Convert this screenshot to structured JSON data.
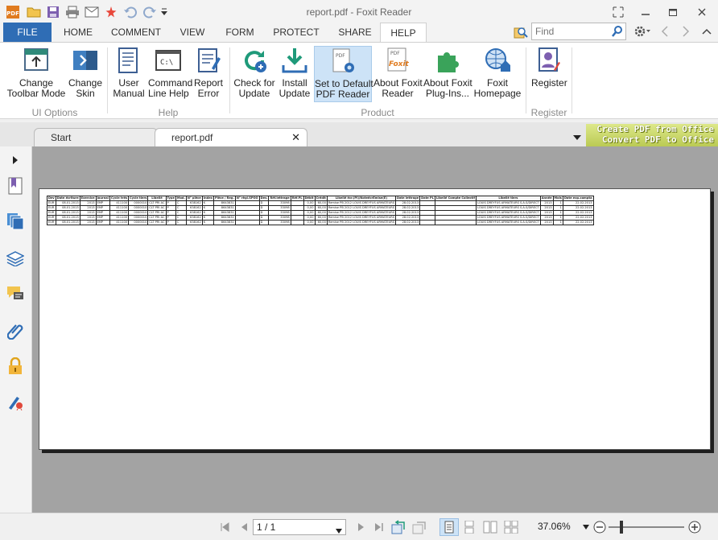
{
  "window": {
    "title": "report.pdf - Foxit Reader"
  },
  "ribbon_tabs": [
    {
      "label": "FILE"
    },
    {
      "label": "HOME"
    },
    {
      "label": "COMMENT"
    },
    {
      "label": "VIEW"
    },
    {
      "label": "FORM"
    },
    {
      "label": "PROTECT"
    },
    {
      "label": "SHARE"
    },
    {
      "label": "HELP"
    }
  ],
  "search": {
    "placeholder": "Find"
  },
  "ribbon": {
    "buttons": [
      {
        "l1": "Change",
        "l2": "Toolbar Mode"
      },
      {
        "l1": "Change",
        "l2": "Skin"
      },
      {
        "l1": "User",
        "l2": "Manual"
      },
      {
        "l1": "Command",
        "l2": "Line Help"
      },
      {
        "l1": "Report",
        "l2": "Error"
      },
      {
        "l1": "Check for",
        "l2": "Update"
      },
      {
        "l1": "Install",
        "l2": "Update"
      },
      {
        "l1": "Set to Default",
        "l2": "PDF Reader"
      },
      {
        "l1": "About Foxit",
        "l2": "Reader"
      },
      {
        "l1": "About Foxit",
        "l2": "Plug-Ins..."
      },
      {
        "l1": "Foxit",
        "l2": "Homepage"
      },
      {
        "l1": "Register",
        "l2": ""
      }
    ],
    "groups": [
      "UI Options",
      "Help",
      "Product",
      "Register"
    ]
  },
  "doc_tabs": [
    {
      "label": "Start"
    },
    {
      "label": "report.pdf"
    }
  ],
  "promo": {
    "line1": "Create PDF from Office",
    "line2": "Convert PDF to Office"
  },
  "pdf_table": {
    "headers": [
      "Dev",
      "Date écriture",
      "Exercice",
      "Journal",
      "Cycle trés",
      "Cycle tiers",
      "Libellé",
      "Type",
      "Mod.",
      "N° pièce",
      "Index",
      "Pièce / Reg.",
      "N° règl.SPOO",
      "Dev.",
      "Réf.lettrage",
      "Réf.PL",
      "Débit",
      "Crédit",
      "Libellé écr.(PI)/NoteécrEmise(E)",
      "Date lettrage",
      "Date PL",
      "Libellé Compte Collectif",
      "Libellé tiers",
      "Année",
      "Mois",
      "Date exp.compta"
    ],
    "rows": [
      [
        "EUR",
        "08.01.2013",
        "2013",
        "EMP",
        "411100",
        "0000010",
        "CLT PRI AC",
        "P",
        "C",
        "638162",
        "K",
        "8643831",
        "",
        "D",
        "33098",
        "",
        "0,00",
        "60,00",
        "Remise PB 2012 LOUIS DREYFUS ARMATEURS",
        "28.02.2013",
        "",
        "",
        "LOUIS DREYFUS ARMATEURS S.A.S/DIRECT",
        "2013",
        "1",
        "22.02.2013"
      ],
      [
        "EUR",
        "08.01.2013",
        "2013",
        "EMP",
        "411100",
        "0000010",
        "CLT PRI AC",
        "P",
        "C",
        "638162",
        "K",
        "8643831",
        "",
        "D",
        "33098",
        "",
        "0,00",
        "60,00",
        "Remise PB 2012 LOUIS DREYFUS ARMATEURS",
        "28.02.2013",
        "",
        "",
        "LOUIS DREYFUS ARMATEURS S.A.S/DIRECT",
        "2013",
        "1",
        "22.02.2013"
      ],
      [
        "EUR",
        "08.01.2013",
        "2013",
        "EMP",
        "411100",
        "0000010",
        "CLT PRI AC",
        "P",
        "C",
        "638162",
        "K",
        "8643831",
        "",
        "D",
        "33098",
        "",
        "0,00",
        "60,00",
        "Remise PB 2012 LOUIS DREYFUS ARMATEURS",
        "28.02.2013",
        "",
        "",
        "LOUIS DREYFUS ARMATEURS S.A.S/DIRECT",
        "2013",
        "1",
        "22.02.2013"
      ],
      [
        "EUR",
        "08.01.2013",
        "2013",
        "EMP",
        "411100",
        "0000010",
        "CLT PRI AC",
        "P",
        "C",
        "638162",
        "K",
        "8643831",
        "",
        "D",
        "33098",
        "",
        "0,00",
        "60,00",
        "Remise PB 2012 LOUIS DREYFUS ARMATEURS",
        "28.02.2013",
        "",
        "",
        "LOUIS DREYFUS ARMATEURS S.A.S/DIRECT",
        "2013",
        "1",
        "22.02.2013"
      ],
      [
        "EUR",
        "08.01.2013",
        "2013",
        "EMP",
        "411100",
        "0000010",
        "CLT PRI AC",
        "P",
        "C",
        "638162",
        "K",
        "8643831",
        "",
        "D",
        "33098",
        "",
        "0,00",
        "60,00",
        "Remise PB 2012 LOUIS DREYFUS ARMATEURS",
        "28.02.2013",
        "",
        "",
        "LOUIS DREYFUS ARMATEURS S.A.S/DIRECT",
        "2013",
        "1",
        "22.02.2013"
      ]
    ]
  },
  "status": {
    "page_value": "1 / 1",
    "zoom": "37.06%"
  },
  "colors": {
    "file_tab": "#2f6db5",
    "selected_button": "#cde3f7",
    "doc_background": "#a3a3a3",
    "promo": "#c9d56a"
  },
  "icons": [
    "foxit-logo-icon",
    "open-icon",
    "save-icon",
    "print-icon",
    "email-icon",
    "new-icon",
    "undo-icon",
    "redo-icon",
    "customize-icon",
    "restore-icon",
    "minimize-icon",
    "maximize-icon",
    "close-icon",
    "find-icon",
    "settings-icon",
    "back-icon",
    "forward-icon",
    "collapse-icon",
    "bookmarks-icon",
    "pages-icon",
    "layers-icon",
    "comments-icon",
    "attachments-icon",
    "security-icon",
    "signatures-icon",
    "first-page-icon",
    "previous-page-icon",
    "next-page-icon",
    "last-page-icon",
    "previous-view-icon",
    "next-view-icon",
    "single-page-icon",
    "continuous-icon",
    "facing-icon",
    "continuous-facing-icon",
    "zoom-out-icon",
    "zoom-in-icon"
  ]
}
